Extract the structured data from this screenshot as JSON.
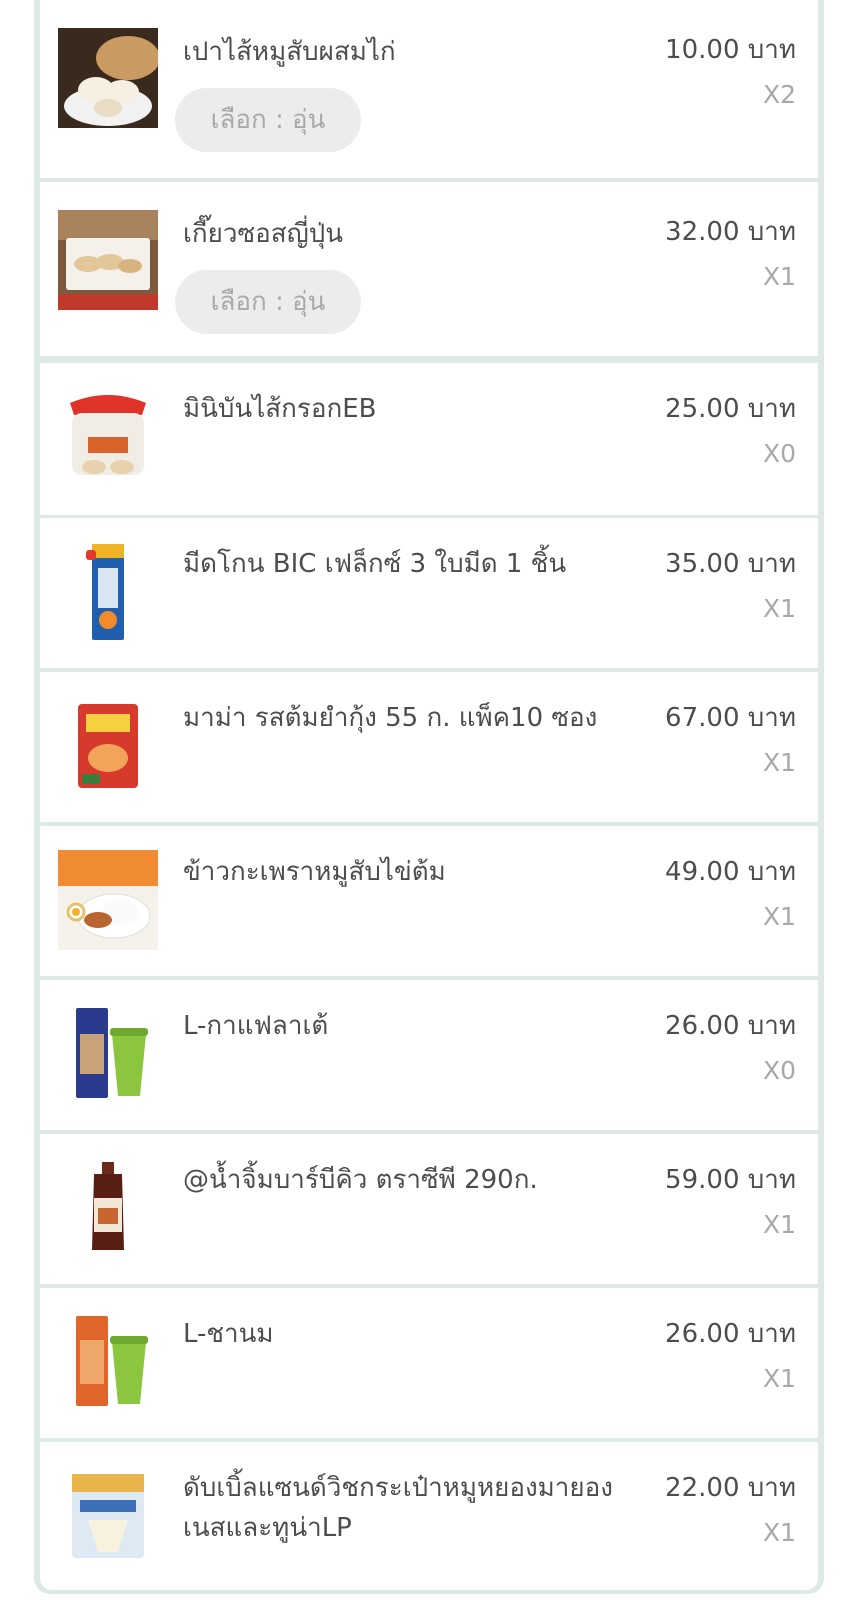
{
  "cart": {
    "items": [
      {
        "name": "เปาไส้หมูสับผสมไก่",
        "price": "10.00 บาท",
        "qty": "X2",
        "option": "เลือก : อุ่น",
        "icon": "steamed-bun-icon"
      },
      {
        "name": "เกี๊ยวซอสญี่ปุ่น",
        "price": "32.00 บาท",
        "qty": "X1",
        "option": "เลือก : อุ่น",
        "icon": "gyoza-icon"
      },
      {
        "name": "มินิบันไส้กรอกEB",
        "price": "25.00 บาท",
        "qty": "X0",
        "icon": "mini-bun-pack-icon"
      },
      {
        "name": "มีดโกน BIC เฟล็กซ์ 3 ใบมีด 1 ชิ้น",
        "price": "35.00 บาท",
        "qty": "X1",
        "icon": "razor-pack-icon"
      },
      {
        "name": "มาม่า รสต้มยำกุ้ง 55 ก.  แพ็ค10 ซอง",
        "price": "67.00 บาท",
        "qty": "X1",
        "icon": "noodle-pack-icon"
      },
      {
        "name": "ข้าวกะเพราหมูสับไข่ต้ม",
        "price": "49.00 บาท",
        "qty": "X1",
        "icon": "rice-meal-icon"
      },
      {
        "name": "L-กาแฟลาเต้",
        "price": "26.00 บาท",
        "qty": "X0",
        "icon": "latte-cup-icon"
      },
      {
        "name": "@น้ำจิ้มบาร์บีคิว ตราซีพี 290ก.",
        "price": "59.00 บาท",
        "qty": "X1",
        "icon": "sauce-bottle-icon"
      },
      {
        "name": "L-ชานม",
        "price": "26.00 บาท",
        "qty": "X1",
        "icon": "milk-tea-cup-icon"
      },
      {
        "name": "ดับเบิ้ลแซนด์วิชกระเป๋าหมูหยองมายองเนสและทูน่าLP",
        "price": "22.00 บาท",
        "qty": "X1",
        "icon": "sandwich-pack-icon"
      }
    ]
  }
}
